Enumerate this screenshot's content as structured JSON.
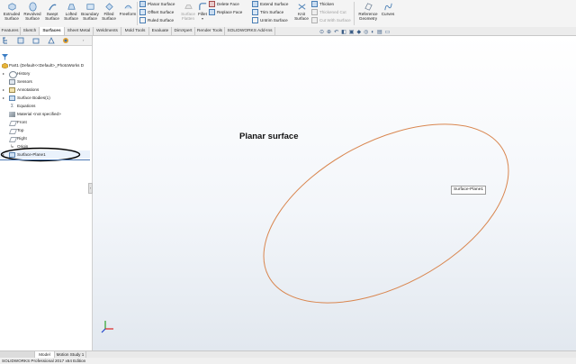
{
  "ribbon": {
    "big_buttons": [
      {
        "label1": "Extruded",
        "label2": "Surface",
        "icon": "extruded-surface-icon"
      },
      {
        "label1": "Revolved",
        "label2": "Surface",
        "icon": "revolved-surface-icon"
      },
      {
        "label1": "Swept",
        "label2": "Surface",
        "icon": "swept-surface-icon"
      },
      {
        "label1": "Lofted",
        "label2": "Surface",
        "icon": "lofted-surface-icon"
      },
      {
        "label1": "Boundary",
        "label2": "Surface",
        "icon": "boundary-surface-icon"
      },
      {
        "label1": "Filled",
        "label2": "Surface",
        "icon": "filled-surface-icon"
      },
      {
        "label1": "Freeform",
        "label2": "",
        "icon": "freeform-icon"
      }
    ],
    "col1": [
      "Planar Surface",
      "Offset Surface",
      "Ruled Surface"
    ],
    "surface_flatten": {
      "label1": "Surface",
      "label2": "Flatten",
      "disabled": true
    },
    "fillet": {
      "label1": "Fillet",
      "label2": ""
    },
    "col2": [
      "Delete Face",
      "Replace Face"
    ],
    "col3": [
      "Extend Surface",
      "Trim Surface",
      "Untrim Surface"
    ],
    "knit": {
      "label1": "Knit",
      "label2": "Surface"
    },
    "col4": [
      "Thicken",
      "Thickened Cut",
      "Cut With Surface"
    ],
    "col4_disabled": [
      false,
      true,
      true
    ],
    "reference_geometry": {
      "label1": "Reference",
      "label2": "Geometry"
    },
    "curves": {
      "label1": "Curves",
      "label2": ""
    }
  },
  "command_tabs": [
    "Features",
    "Sketch",
    "Surfaces",
    "Sheet Metal",
    "Weldments",
    "Mold Tools",
    "Evaluate",
    "DimXpert",
    "Render Tools",
    "SOLIDWORKS Add-Ins"
  ],
  "active_tab": "Surfaces",
  "tree": {
    "root": "Part1  (Default<<Default>_PhotoWorks D",
    "items": [
      {
        "label": "History",
        "expandable": true,
        "icon": "history-icon"
      },
      {
        "label": "Sensors",
        "expandable": false,
        "icon": "sensors-icon"
      },
      {
        "label": "Annotations",
        "expandable": true,
        "icon": "annotations-icon"
      },
      {
        "label": "Surface Bodies(1)",
        "expandable": true,
        "icon": "surface-bodies-icon"
      },
      {
        "label": "Equations",
        "expandable": false,
        "icon": "equations-icon"
      },
      {
        "label": "Material <not specified>",
        "expandable": false,
        "icon": "material-icon"
      },
      {
        "label": "Front",
        "expandable": false,
        "icon": "plane-icon"
      },
      {
        "label": "Top",
        "expandable": false,
        "icon": "plane-icon"
      },
      {
        "label": "Right",
        "expandable": false,
        "icon": "plane-icon"
      },
      {
        "label": "Origin",
        "expandable": false,
        "icon": "origin-icon"
      },
      {
        "label": "Surface-Plane1",
        "expandable": true,
        "icon": "surface-plane-icon",
        "highlighted": true
      }
    ]
  },
  "viewport": {
    "annotation": "Planar surface",
    "tooltip": "Surface-Plane1",
    "colors": {
      "highlight_circle": "#000000",
      "surface_edge": "#d9864f"
    }
  },
  "bottom_tabs": [
    "Model",
    "Motion Study 1"
  ],
  "active_bottom_tab": "Model",
  "status": "SOLIDWORKS Professional 2017 x64 Edition"
}
